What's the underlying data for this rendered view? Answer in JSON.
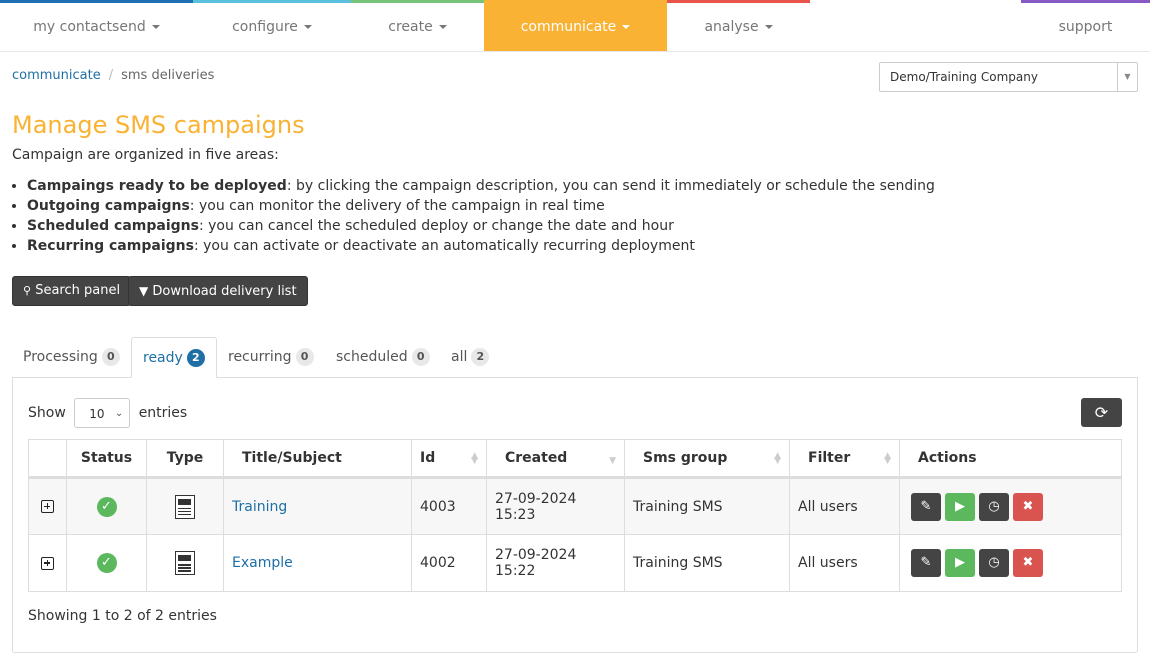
{
  "nav": {
    "colors": [
      "#1f6fb5",
      "#5bc0de",
      "#76c47a",
      "#f9b233",
      "#e8534a",
      "#8659c4"
    ],
    "items": [
      {
        "label": "my contactsend",
        "has_caret": true
      },
      {
        "label": "configure",
        "has_caret": true
      },
      {
        "label": "create",
        "has_caret": true
      },
      {
        "label": "communicate",
        "has_caret": true,
        "active": true
      },
      {
        "label": "analyse",
        "has_caret": true
      },
      {
        "label": "support",
        "has_caret": false
      }
    ]
  },
  "breadcrumb": {
    "parent": "communicate",
    "separator": "/",
    "current": "sms deliveries"
  },
  "company_select": {
    "value": "Demo/Training Company"
  },
  "page": {
    "title": "Manage SMS campaigns",
    "intro": "Campaign are organized in five areas:",
    "areas": [
      {
        "bold": "Campaings ready to be deployed",
        "text": ": by clicking the campaign description, you can send it immediately or schedule the sending"
      },
      {
        "bold": "Outgoing campaigns",
        "text": ": you can monitor the delivery of the campaign in real time"
      },
      {
        "bold": "Scheduled campaigns",
        "text": ": you can cancel the scheduled deploy or change the date and hour"
      },
      {
        "bold": "Recurring campaigns",
        "text": ": you can activate or deactivate an automatically recurring deployment"
      }
    ]
  },
  "buttons": {
    "search_panel": "Search panel",
    "download": "Download delivery list"
  },
  "tabs": [
    {
      "label": "Processing",
      "count": "0"
    },
    {
      "label": "ready",
      "count": "2",
      "active": true
    },
    {
      "label": "recurring",
      "count": "0"
    },
    {
      "label": "scheduled",
      "count": "0"
    },
    {
      "label": "all",
      "count": "2"
    }
  ],
  "table": {
    "show_label": "Show",
    "page_size": "10",
    "entries_label": "entries",
    "columns": [
      "",
      "Status",
      "Type",
      "Title/Subject",
      "Id",
      "Created",
      "Sms group",
      "Filter",
      "Actions"
    ],
    "rows": [
      {
        "status": "ok",
        "type": "sms",
        "title": "Training",
        "id": "4003",
        "created_date": "27-09-2024",
        "created_time": "15:23",
        "group": "Training SMS",
        "filter": "All users"
      },
      {
        "status": "ok",
        "type": "sms",
        "title": "Example",
        "id": "4002",
        "created_date": "27-09-2024",
        "created_time": "15:22",
        "group": "Training SMS",
        "filter": "All users"
      }
    ],
    "info": "Showing 1 to 2 of 2 entries"
  },
  "icons": {
    "search": "🔍",
    "download": "⊕",
    "refresh": "⟳",
    "check": "✓",
    "edit": "✎",
    "play": "▶",
    "clock": "◷",
    "close": "✖"
  }
}
